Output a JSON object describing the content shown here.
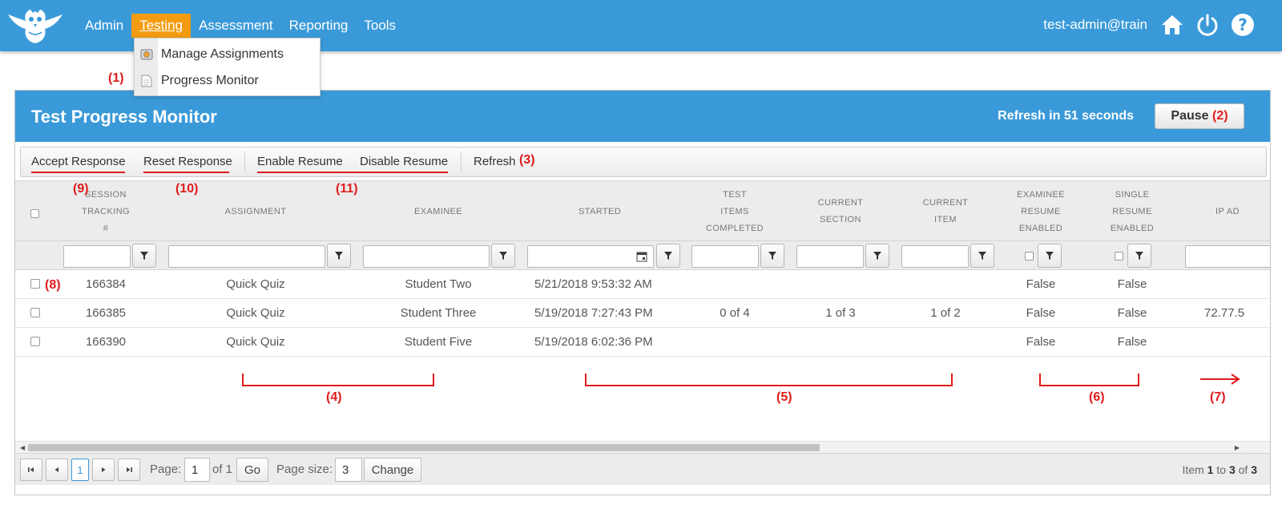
{
  "nav": {
    "items": [
      {
        "label": "Admin"
      },
      {
        "label": "Testing"
      },
      {
        "label": "Assessment"
      },
      {
        "label": "Reporting"
      },
      {
        "label": "Tools"
      }
    ],
    "user": "test-admin@train",
    "accent_color": "#3a9ad9",
    "active_color": "#f39c12",
    "icons": [
      "owl-logo-icon",
      "home-icon",
      "power-icon",
      "help-icon"
    ]
  },
  "dropdown": {
    "items": [
      {
        "label": "Manage Assignments",
        "icon": "assignments-icon"
      },
      {
        "label": "Progress Monitor",
        "icon": "document-icon"
      }
    ]
  },
  "panel": {
    "title": "Test Progress Monitor",
    "refresh_text": "Refresh in 51 seconds",
    "pause_label": "Pause"
  },
  "toolbar": {
    "accept": "Accept Response",
    "reset": "Reset Response",
    "enable": "Enable Resume",
    "disable": "Disable Resume",
    "refresh": "Refresh"
  },
  "columns": {
    "session_l1": "Session Tracking",
    "session_l2": "#",
    "assignment": "Assignment",
    "examinee": "Examinee",
    "started": "Started",
    "items_l1": "Test",
    "items_l2": "Items",
    "items_l3": "Completed",
    "section_l1": "Current",
    "section_l2": "Section",
    "item_l1": "Current",
    "item_l2": "Item",
    "exres_l1": "Examinee",
    "exres_l2": "Resume",
    "exres_l3": "Enabled",
    "single_l1": "Single",
    "single_l2": "Resume",
    "single_l3": "Enabled",
    "ip": "IP Ad"
  },
  "rows": [
    {
      "session": "166384",
      "assignment": "Quick Quiz",
      "examinee": "Student Two",
      "started": "5/21/2018 9:53:32 AM",
      "items": "",
      "section": "",
      "item": "",
      "exres": "False",
      "single": "False",
      "ip": ""
    },
    {
      "session": "166385",
      "assignment": "Quick Quiz",
      "examinee": "Student Three",
      "started": "5/19/2018 7:27:43 PM",
      "items": "0 of 4",
      "section": "1 of 3",
      "item": "1 of 2",
      "exres": "False",
      "single": "False",
      "ip": "72.77.5"
    },
    {
      "session": "166390",
      "assignment": "Quick Quiz",
      "examinee": "Student Five",
      "started": "5/19/2018 6:02:36 PM",
      "items": "",
      "section": "",
      "item": "",
      "exres": "False",
      "single": "False",
      "ip": ""
    }
  ],
  "pager": {
    "current_page": "1",
    "page_label": "Page:",
    "page_value": "1",
    "of_text": "of 1",
    "go_label": "Go",
    "size_label": "Page size:",
    "size_value": "3",
    "change_label": "Change",
    "info_item": "Item",
    "info_from": "1",
    "info_to_word": "to",
    "info_to": "3",
    "info_of_word": "of",
    "info_total": "3"
  },
  "annotations": [
    "(1)",
    "(2)",
    "(3)",
    "(4)",
    "(5)",
    "(6)",
    "(7)",
    "(8)",
    "(9)",
    "(10)",
    "(11)"
  ]
}
